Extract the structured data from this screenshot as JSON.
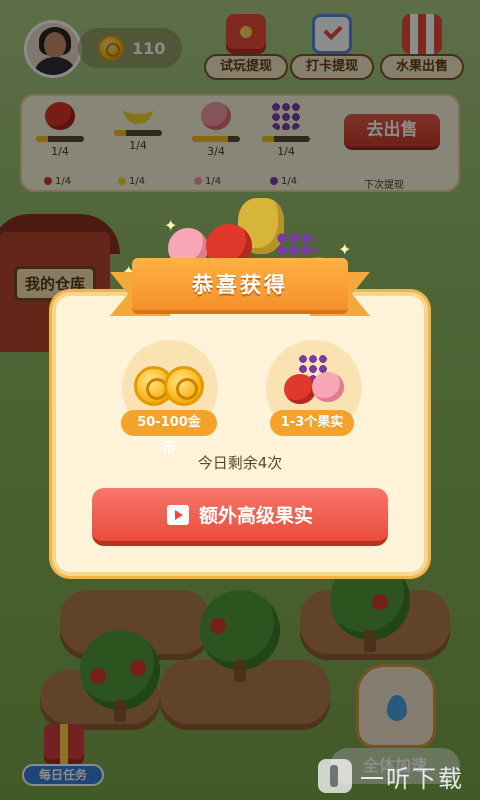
{
  "header": {
    "coin_count": "110",
    "buttons": [
      {
        "label": "试玩提现",
        "icon": "red-envelope-icon"
      },
      {
        "label": "打卡提现",
        "icon": "calendar-check-icon"
      },
      {
        "label": "水果出售",
        "icon": "fruit-shop-icon"
      }
    ]
  },
  "fruit_panel": {
    "fruits": [
      {
        "name": "apple",
        "count": "1/4",
        "mini": "1/4",
        "progress": 0.25
      },
      {
        "name": "banana",
        "count": "1/4",
        "mini": "1/4",
        "progress": 0.25
      },
      {
        "name": "peach",
        "count": "3/4",
        "mini": "1/4",
        "progress": 0.75
      },
      {
        "name": "grape",
        "count": "1/4",
        "mini": "1/4",
        "progress": 0.25
      }
    ],
    "sell_label": "去出售",
    "next_withdraw": "下次提现"
  },
  "scene": {
    "barn_sign": "我的仓库"
  },
  "modal": {
    "title": "恭喜获得",
    "coins_reward": "50-100金币",
    "fruit_reward": "1-3个果实",
    "remaining": "今日剩余4次",
    "extra_button": "额外高级果实"
  },
  "bottom": {
    "daily_task": "每日任务",
    "speed_up": "全体加速",
    "watermark": "一听下载"
  },
  "colors": {
    "accent_orange": "#f5902a",
    "button_red": "#ea4b3c",
    "panel_cream": "#fff3d9"
  }
}
